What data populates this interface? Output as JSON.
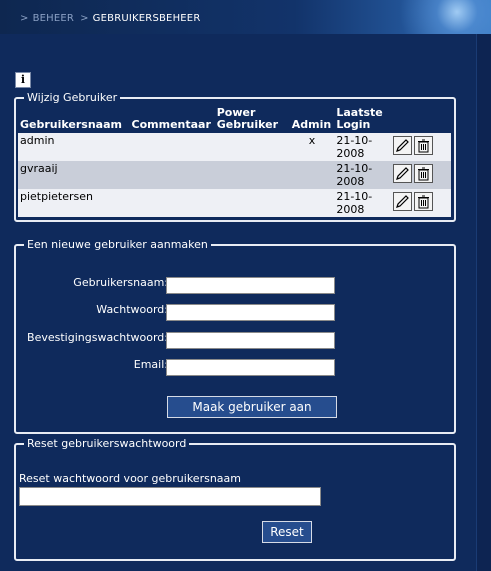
{
  "breadcrumb": {
    "separator": ">",
    "parent": "BEHEER",
    "current": "GEBRUIKERSBEHEER"
  },
  "info_icon": "i",
  "users_section": {
    "legend": "Wijzig Gebruiker",
    "headers": [
      "Gebruikersnaam",
      "Commentaar",
      "Power Gebruiker",
      "Admin",
      "Laatste Login"
    ],
    "rows": [
      {
        "name": "admin",
        "comment": "",
        "power": "",
        "admin": "x",
        "last_login": "21-10-2008"
      },
      {
        "name": "gvraaij",
        "comment": "",
        "power": "",
        "admin": "",
        "last_login": "21-10-2008"
      },
      {
        "name": "pietpietersen",
        "comment": "",
        "power": "",
        "admin": "",
        "last_login": "21-10-2008"
      }
    ],
    "edit_icon": "pencil-icon",
    "delete_icon": "trash-icon"
  },
  "create_section": {
    "legend": "Een nieuwe gebruiker aanmaken",
    "fields": {
      "username": {
        "label": "Gebruikersnaam:",
        "value": ""
      },
      "password": {
        "label": "Wachtwoord:",
        "value": ""
      },
      "confirm": {
        "label": "Bevestigingswachtwoord:",
        "value": ""
      },
      "email": {
        "label": "Email:",
        "value": ""
      }
    },
    "submit_label": "Maak gebruiker aan"
  },
  "reset_section": {
    "legend": "Reset gebruikerswachtwoord",
    "label": "Reset wachtwoord voor gebruikersnaam",
    "value": "",
    "button_label": "Reset"
  },
  "colors": {
    "background": "#0f2a5c",
    "row_light": "#eef0f5",
    "row_dark": "#c9ced9",
    "button": "#264d8e"
  }
}
